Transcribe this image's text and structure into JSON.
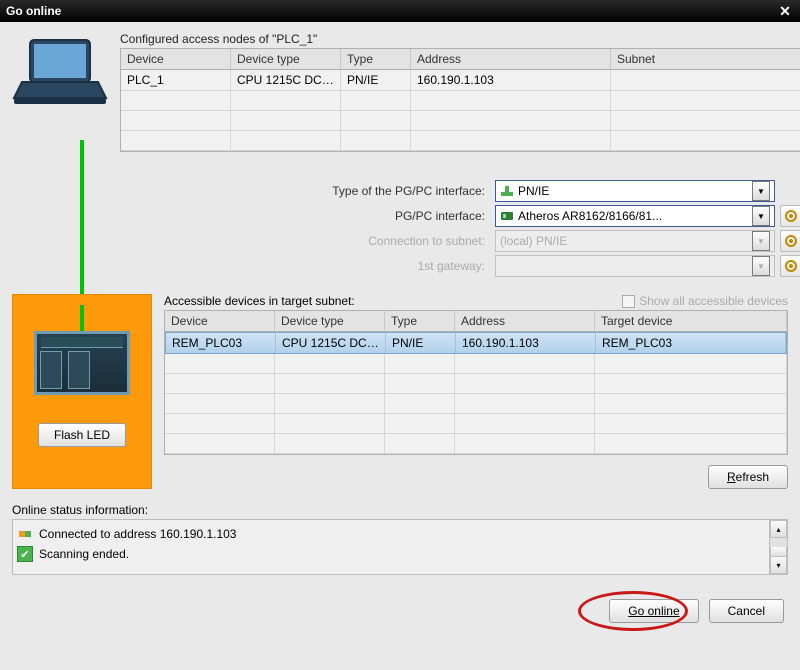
{
  "dialog": {
    "title": "Go online"
  },
  "configured": {
    "label_prefix": "Configured access nodes of ",
    "target_name": "\"PLC_1\"",
    "headers": {
      "device": "Device",
      "type": "Device type",
      "iftype": "Type",
      "addr": "Address",
      "subnet": "Subnet"
    },
    "rows": [
      {
        "device": "PLC_1",
        "type": "CPU 1215C DC/D...",
        "iftype": "PN/IE",
        "addr": "160.190.1.103",
        "subnet": ""
      }
    ]
  },
  "interface": {
    "label_type": "Type of the PG/PC interface:",
    "label_if": "PG/PC interface:",
    "label_conn": "Connection to subnet:",
    "label_gw": "1st gateway:",
    "sel_type": "PN/IE",
    "sel_if": "Atheros AR8162/8166/81...",
    "sel_conn": "(local) PN/IE",
    "sel_gw": ""
  },
  "accessible": {
    "label": "Accessible devices in target subnet:",
    "show_all": "Show all accessible devices",
    "headers": {
      "device": "Device",
      "type": "Device type",
      "iftype": "Type",
      "addr": "Address",
      "target": "Target device"
    },
    "rows": [
      {
        "device": "REM_PLC03",
        "type": "CPU 1215C DC/D...",
        "iftype": "PN/IE",
        "addr": "160.190.1.103",
        "target": "REM_PLC03"
      }
    ]
  },
  "flash_led": "Flash LED",
  "refresh": "Refresh",
  "status": {
    "label": "Online status information:",
    "lines": [
      {
        "text": "Connected to address 160.190.1.103",
        "icon": "link"
      },
      {
        "text": "Scanning ended.",
        "icon": "check"
      }
    ]
  },
  "buttons": {
    "go": "Go online",
    "cancel": "Cancel"
  }
}
